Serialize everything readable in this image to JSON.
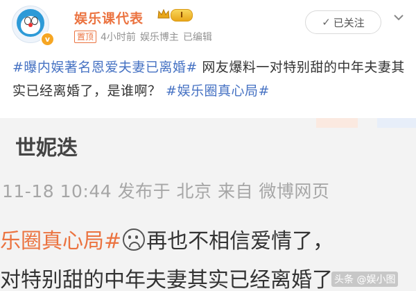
{
  "header": {
    "account_name": "娱乐课代表",
    "level_badge": "I",
    "pinned_label": "置顶",
    "time": "4小时前",
    "role": "娱乐博主",
    "edited": "已编辑",
    "follow_label": "已关注",
    "verified_icon": "v-badge-icon",
    "colors": {
      "name": "#eb7340",
      "topic": "#4672c3",
      "level_badge": "#f3c03b"
    }
  },
  "post": {
    "topic1": "#曝内娱著名恩爱夫妻已离婚#",
    "text": " 网友爆料一对特别甜的中年夫妻其实已经离婚了，是谁啊？ ",
    "topic2": "#娱乐圈真心局#"
  },
  "embed": {
    "line1": "世妮迭",
    "line2": "11-18 10:44  发布于 北京  来自 微博网页",
    "line3_topic": "乐圈真心局#",
    "line3_text": "再也不相信爱情了，",
    "line4": "对特别甜的中年夫妻其实已经离婚了"
  },
  "watermark": "头条 @娱小图"
}
